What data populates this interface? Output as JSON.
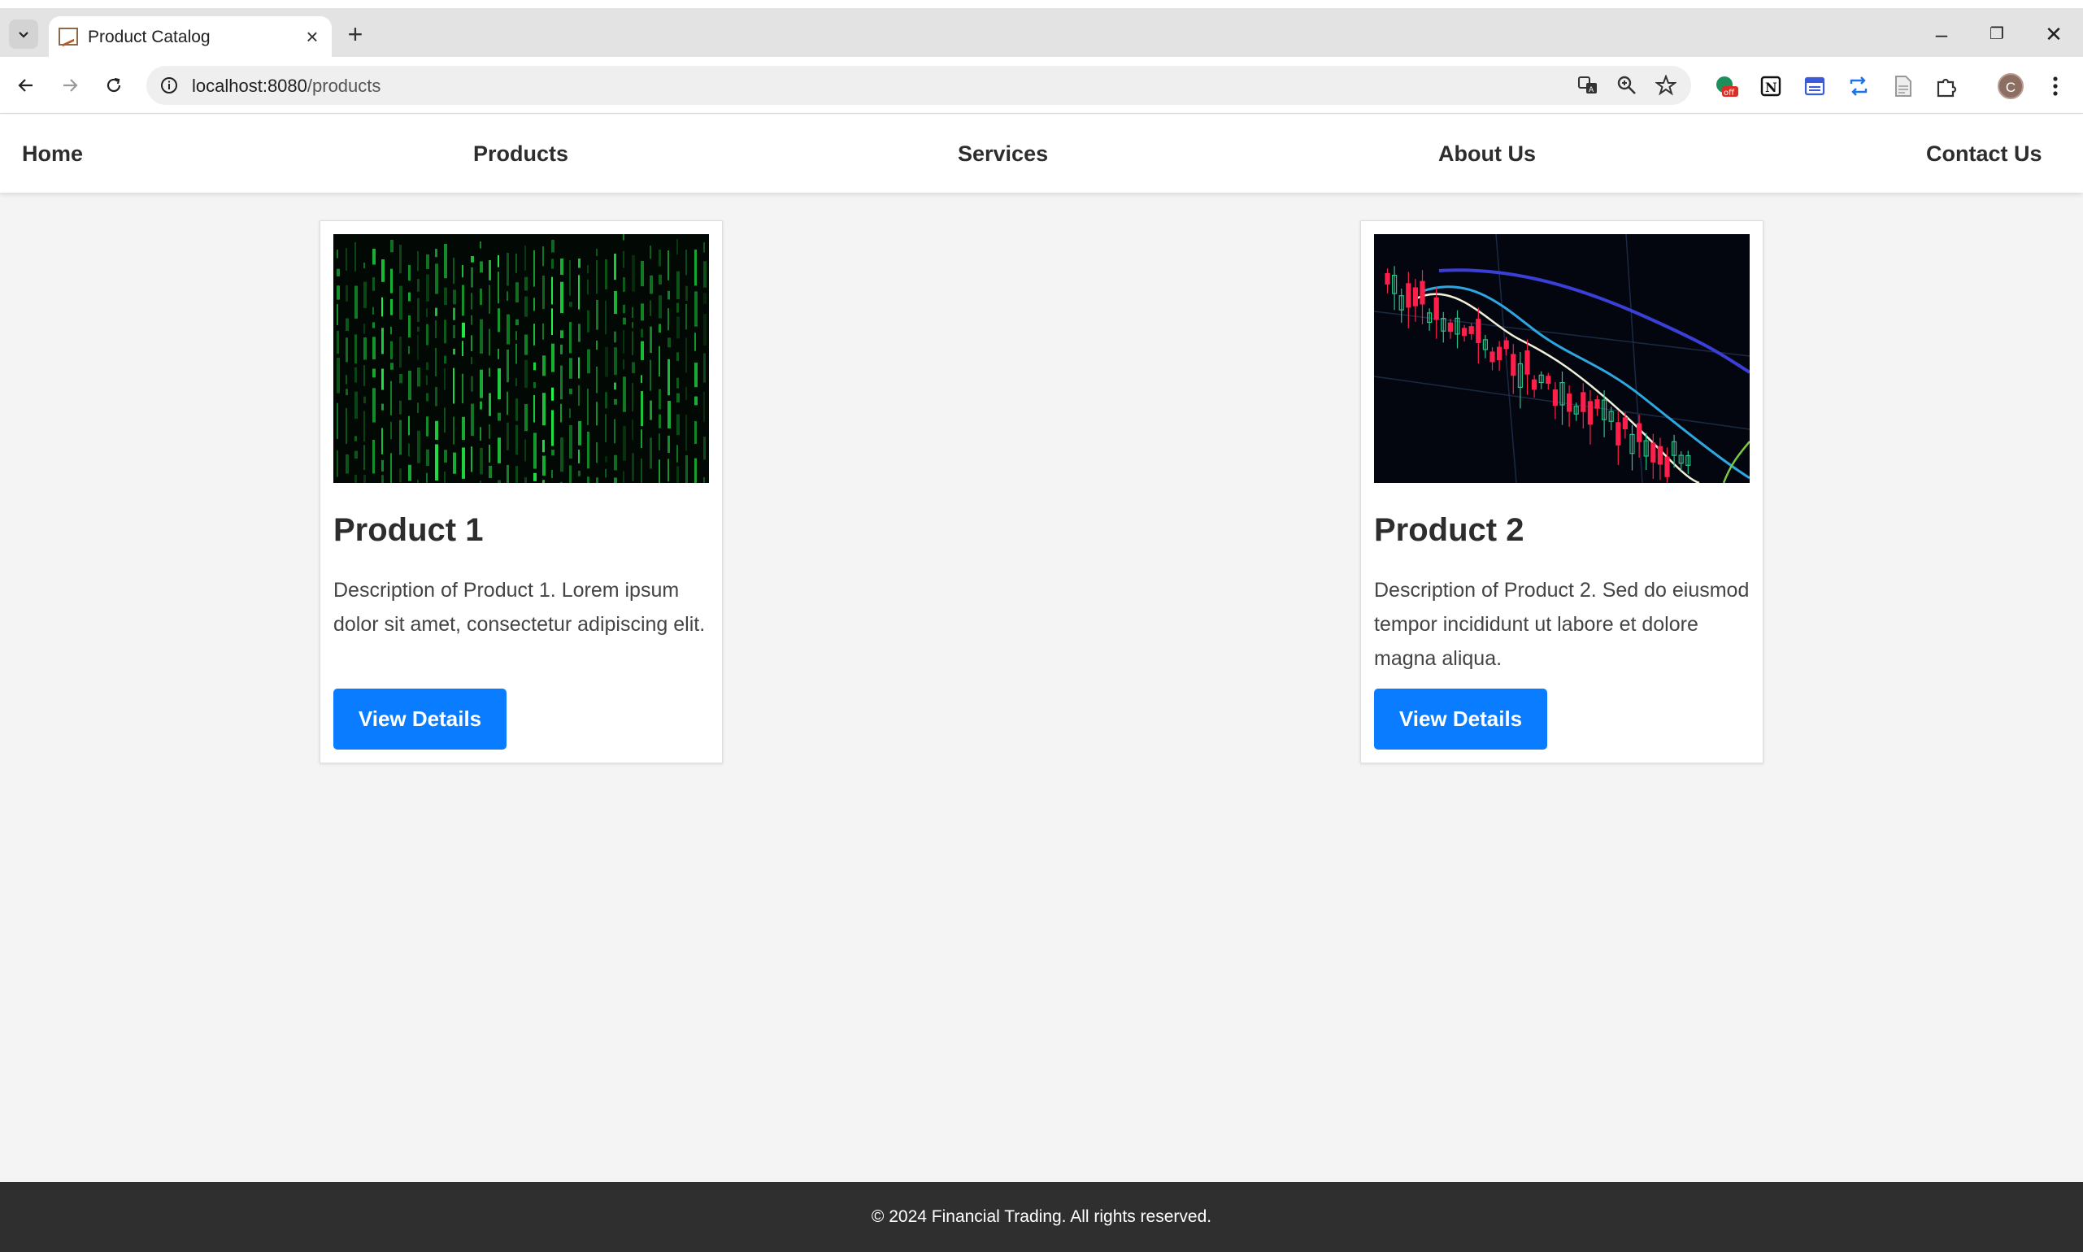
{
  "browser": {
    "tab_title": "Product Catalog",
    "url_host": "localhost:8080",
    "url_path": "/products",
    "profile_initial": "C",
    "extension_badge": "off"
  },
  "nav": {
    "items": [
      {
        "label": "Home"
      },
      {
        "label": "Products"
      },
      {
        "label": "Services"
      },
      {
        "label": "About Us"
      },
      {
        "label": "Contact Us"
      }
    ]
  },
  "products": [
    {
      "title": "Product 1",
      "description": "Description of Product 1. Lorem ipsum dolor sit amet, consectetur adipiscing elit.",
      "button_label": "View Details",
      "image_icon": "matrix-code-image"
    },
    {
      "title": "Product 2",
      "description": "Description of Product 2. Sed do eiusmod tempor incididunt ut labore et dolore magna aliqua.",
      "button_label": "View Details",
      "image_icon": "candlestick-chart-image"
    }
  ],
  "footer": {
    "text": "© 2024 Financial Trading. All rights reserved."
  },
  "colors": {
    "accent": "#0a7cff",
    "footer_bg": "#2f2f2f",
    "page_bg": "#f4f4f4"
  }
}
